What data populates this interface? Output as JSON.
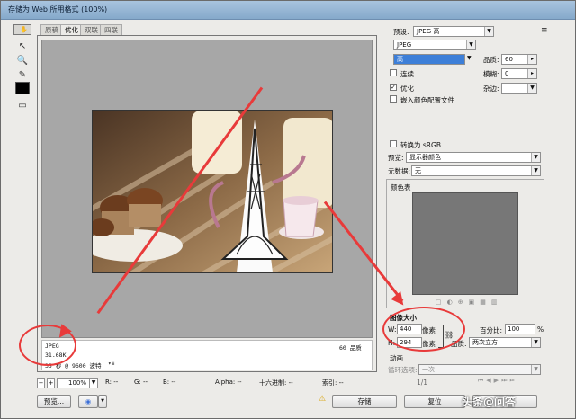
{
  "window": {
    "title": "存储为 Web 所用格式 (100%)"
  },
  "tabs": [
    "原稿",
    "优化",
    "双联",
    "四联"
  ],
  "info": {
    "format": "JPEG",
    "size": "31.68K",
    "time": "35 秒 @ 9600 波特",
    "quality": "60 品质"
  },
  "status": {
    "zoom": "100%",
    "r": "R: --",
    "g": "G: --",
    "b": "B: --",
    "alpha": "Alpha: --",
    "hex": "十六进制: --",
    "index": "索引: --"
  },
  "buttons": {
    "preview": "预览...",
    "save": "存储",
    "reset": "复位"
  },
  "settings": {
    "preset_label": "预设:",
    "preset_value": "JPEG 高",
    "format_value": "JPEG",
    "compression_value": "高",
    "quality_label": "品质:",
    "quality_value": "60",
    "progressive_label": "连续",
    "blur_label": "模糊:",
    "blur_value": "0",
    "optimized_label": "优化",
    "matte_label": "杂边:",
    "embed_profile_label": "嵌入颜色配置文件",
    "convert_srgb_label": "转换为 sRGB",
    "preview_label": "预览:",
    "preview_value": "显示器颜色",
    "metadata_label": "元数据:",
    "metadata_value": "无",
    "color_table_label": "颜色表"
  },
  "image_size": {
    "title": "图像大小",
    "w_label": "W:",
    "w_value": "440",
    "h_label": "H:",
    "h_value": "294",
    "unit": "像素",
    "percent_label": "百分比:",
    "percent_value": "100",
    "percent_unit": "%",
    "quality_label": "品质:",
    "quality_value": "两次立方"
  },
  "animation": {
    "title": "动画",
    "loop_label": "循环选项:",
    "loop_value": "一次",
    "frame": "1/1"
  },
  "watermark": "头条@问答",
  "colors": {
    "accent": "#e83a3a",
    "selection": "#3d7fd8"
  }
}
